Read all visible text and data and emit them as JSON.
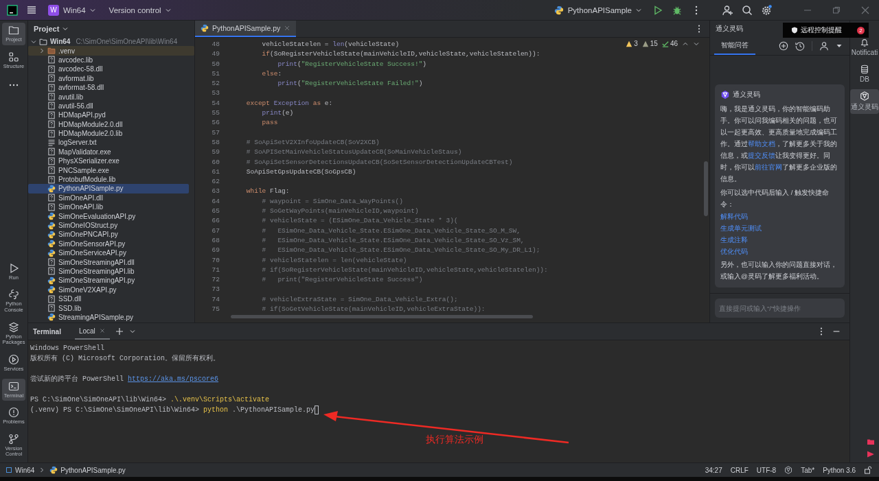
{
  "title_bar": {
    "project_badge": "W",
    "project": "Win64",
    "vcs": "Version control",
    "run_config": "PythonAPISample",
    "settings_dot": true
  },
  "tool_strip": {
    "top": [
      {
        "label": "Project",
        "kind": "folder",
        "selected": true
      },
      {
        "label": "Structure",
        "kind": "structure",
        "selected": false
      }
    ],
    "bottom": [
      {
        "label": "Run",
        "kind": "run",
        "selected": false
      },
      {
        "label": "Python Console",
        "kind": "console",
        "selected": false
      },
      {
        "label": "Python Packages",
        "kind": "packages",
        "selected": false
      },
      {
        "label": "Services",
        "kind": "services",
        "selected": false
      },
      {
        "label": "Terminal",
        "kind": "terminal",
        "selected": true
      },
      {
        "label": "Problems",
        "kind": "problems",
        "selected": false
      },
      {
        "label": "Version Control",
        "kind": "vcs",
        "selected": false
      }
    ]
  },
  "project": {
    "title": "Project",
    "tree": [
      {
        "name": "Win64",
        "path": "C:\\SimOne\\SimOneAPI\\lib\\Win64",
        "kind": "folder",
        "expanded": true,
        "selected": false,
        "children": [
          {
            "name": ".venv",
            "kind": "venv",
            "expanded": false,
            "selected": false
          },
          {
            "name": "avcodec.lib",
            "kind": "binary",
            "selected": false
          },
          {
            "name": "avcodec-58.dll",
            "kind": "binary",
            "selected": false
          },
          {
            "name": "avformat.lib",
            "kind": "binary",
            "selected": false
          },
          {
            "name": "avformat-58.dll",
            "kind": "binary",
            "selected": false
          },
          {
            "name": "avutil.lib",
            "kind": "binary",
            "selected": false
          },
          {
            "name": "avutil-56.dll",
            "kind": "binary",
            "selected": false
          },
          {
            "name": "HDMapAPI.pyd",
            "kind": "binary",
            "selected": false
          },
          {
            "name": "HDMapModule2.0.dll",
            "kind": "binary",
            "selected": false
          },
          {
            "name": "HDMapModule2.0.lib",
            "kind": "binary",
            "selected": false
          },
          {
            "name": "logServer.txt",
            "kind": "text",
            "selected": false
          },
          {
            "name": "MapValidator.exe",
            "kind": "binary",
            "selected": false
          },
          {
            "name": "PhysXSerializer.exe",
            "kind": "binary",
            "selected": false
          },
          {
            "name": "PNCSample.exe",
            "kind": "binary",
            "selected": false
          },
          {
            "name": "ProtobufModule.lib",
            "kind": "binary",
            "selected": false
          },
          {
            "name": "PythonAPISample.py",
            "kind": "python",
            "selected": true
          },
          {
            "name": "SimOneAPI.dll",
            "kind": "binary",
            "selected": false
          },
          {
            "name": "SimOneAPI.lib",
            "kind": "binary",
            "selected": false
          },
          {
            "name": "SimOneEvaluationAPI.py",
            "kind": "python",
            "selected": false
          },
          {
            "name": "SimOneIOStruct.py",
            "kind": "python",
            "selected": false
          },
          {
            "name": "SimOnePNCAPI.py",
            "kind": "python",
            "selected": false
          },
          {
            "name": "SimOneSensorAPI.py",
            "kind": "python",
            "selected": false
          },
          {
            "name": "SimOneServiceAPI.py",
            "kind": "python",
            "selected": false
          },
          {
            "name": "SimOneStreamingAPI.dll",
            "kind": "binary",
            "selected": false
          },
          {
            "name": "SimOneStreamingAPI.lib",
            "kind": "binary",
            "selected": false
          },
          {
            "name": "SimOneStreamingAPI.py",
            "kind": "python",
            "selected": false
          },
          {
            "name": "SimOneV2XAPI.py",
            "kind": "python",
            "selected": false
          },
          {
            "name": "SSD.dll",
            "kind": "binary",
            "selected": false
          },
          {
            "name": "SSD.lib",
            "kind": "binary",
            "selected": false
          },
          {
            "name": "StreamingAPISample.py",
            "kind": "python",
            "selected": false
          }
        ]
      }
    ]
  },
  "editor": {
    "tabs": [
      {
        "label": "PythonAPISample.py",
        "selected": true
      }
    ],
    "inspections": [
      {
        "kind": "error",
        "count": "3"
      },
      {
        "kind": "warning",
        "count": "15"
      },
      {
        "kind": "typo",
        "count": "46"
      }
    ],
    "lines": [
      {
        "number": "48",
        "tokens": [
          {
            "text": "        vehicleStatelen = ",
            "kind": "plain"
          },
          {
            "text": "len",
            "kind": "builtin"
          },
          {
            "text": "(vehicleState)",
            "kind": "plain"
          }
        ]
      },
      {
        "number": "49",
        "tokens": [
          {
            "text": "        if",
            "kind": "keyword"
          },
          {
            "text": "(SoRegisterVehicleState(mainVehicleID,vehicleState,vehicleStatelen)):",
            "kind": "plain"
          }
        ]
      },
      {
        "number": "50",
        "tokens": [
          {
            "text": "            print",
            "kind": "builtin"
          },
          {
            "text": "(",
            "kind": "plain"
          },
          {
            "text": "\"RegisterVehicleState Success!\"",
            "kind": "string"
          },
          {
            "text": ")",
            "kind": "plain"
          }
        ]
      },
      {
        "number": "51",
        "tokens": [
          {
            "text": "        else",
            "kind": "keyword"
          },
          {
            "text": ":",
            "kind": "plain"
          }
        ]
      },
      {
        "number": "52",
        "tokens": [
          {
            "text": "            print",
            "kind": "builtin"
          },
          {
            "text": "(",
            "kind": "plain"
          },
          {
            "text": "\"RegisterVehicleState Failed!\"",
            "kind": "string"
          },
          {
            "text": ")",
            "kind": "plain"
          }
        ]
      },
      {
        "number": "53"
      },
      {
        "number": "54",
        "tokens": [
          {
            "text": "    except ",
            "kind": "keyword"
          },
          {
            "text": "Exception",
            "kind": "builtin"
          },
          {
            "text": " as ",
            "kind": "keyword"
          },
          {
            "text": "e:",
            "kind": "plain"
          }
        ]
      },
      {
        "number": "55",
        "tokens": [
          {
            "text": "        print",
            "kind": "builtin"
          },
          {
            "text": "(e)",
            "kind": "plain"
          }
        ]
      },
      {
        "number": "56",
        "tokens": [
          {
            "text": "        pass",
            "kind": "keyword"
          }
        ]
      },
      {
        "number": "57"
      },
      {
        "number": "58",
        "tokens": [
          {
            "text": "    # SoApiSetV2XInfoUpdateCB(SoV2XCB)",
            "kind": "comment"
          }
        ]
      },
      {
        "number": "59",
        "tokens": [
          {
            "text": "    # SoAPISetMainVehicleStatusUpdateCB(SoMainVehicleStaus)",
            "kind": "comment"
          }
        ]
      },
      {
        "number": "60",
        "tokens": [
          {
            "text": "    # SoApiSetSensorDetectionsUpdateCB(SoSetSensorDetectionUpdateCBTest)",
            "kind": "comment"
          }
        ]
      },
      {
        "number": "61",
        "tokens": [
          {
            "text": "    SoApiSetGpsUpdateCB(SoGpsCB)",
            "kind": "plain"
          }
        ]
      },
      {
        "number": "62"
      },
      {
        "number": "63",
        "tokens": [
          {
            "text": "    while",
            "kind": "keyword"
          },
          {
            "text": " Flag:",
            "kind": "plain"
          }
        ]
      },
      {
        "number": "64",
        "tokens": [
          {
            "text": "        # waypoint = SimOne_Data_WayPoints()",
            "kind": "comment"
          }
        ]
      },
      {
        "number": "65",
        "tokens": [
          {
            "text": "        # SoGetWayPoints(mainVehicleID,waypoint)",
            "kind": "comment"
          }
        ]
      },
      {
        "number": "66",
        "tokens": [
          {
            "text": "        # vehicleState = (ESimOne_Data_Vehicle_State * 3)(",
            "kind": "comment"
          }
        ]
      },
      {
        "number": "67",
        "tokens": [
          {
            "text": "        #   ESimOne_Data_Vehicle_State.ESimOne_Data_Vehicle_State_SO_M_SW,",
            "kind": "comment"
          }
        ]
      },
      {
        "number": "68",
        "tokens": [
          {
            "text": "        #   ESimOne_Data_Vehicle_State.ESimOne_Data_Vehicle_State_SO_Vz_SM,",
            "kind": "comment"
          }
        ]
      },
      {
        "number": "69",
        "tokens": [
          {
            "text": "        #   ESimOne_Data_Vehicle_State.ESimOne_Data_Vehicle_State_SO_My_DR_L1);",
            "kind": "comment"
          }
        ]
      },
      {
        "number": "70",
        "tokens": [
          {
            "text": "        # vehicleStatelen = len(vehicleState)",
            "kind": "comment"
          }
        ]
      },
      {
        "number": "71",
        "tokens": [
          {
            "text": "        # if(SoRegisterVehicleState(mainVehicleID,vehicleState,vehicleStatelen)):",
            "kind": "comment"
          }
        ]
      },
      {
        "number": "72",
        "tokens": [
          {
            "text": "        #   print(\"RegisterVehicleState Success\")",
            "kind": "comment"
          }
        ]
      },
      {
        "number": "73"
      },
      {
        "number": "74",
        "tokens": [
          {
            "text": "        # vehicleExtraState = SimOne_Data_Vehicle_Extra();",
            "kind": "comment"
          }
        ]
      },
      {
        "number": "75",
        "tokens": [
          {
            "text": "        # if(SoGetVehicleState(mainVehicleID,vehicleExtraState)):",
            "kind": "comment"
          }
        ]
      }
    ]
  },
  "assistant": {
    "title": "通义灵码",
    "tabs": [
      {
        "label": "智能问答",
        "selected": true
      }
    ],
    "card_title": "通义灵码",
    "intro": [
      {
        "kind": "text",
        "text": "嗨，我是通义灵码，你的智能编码助手。你可以问我编码相关的问题，也可以一起更高效、更高质量地完成编码工作。通过"
      },
      {
        "kind": "link",
        "text": "帮助文档"
      },
      {
        "kind": "text",
        "text": "，了解更多关于我的信息，或"
      },
      {
        "kind": "link",
        "text": "提交反馈"
      },
      {
        "kind": "text",
        "text": "让我变得更好。同时，你可以"
      },
      {
        "kind": "link",
        "text": "前往官网"
      },
      {
        "kind": "text",
        "text": "了解更多企业版的信息。"
      }
    ],
    "hint": "你可以选中代码后输入 / 触发快捷命令：",
    "commands": [
      "解释代码",
      "生成单元测试",
      "生成注释",
      "优化代码"
    ],
    "outro": "另外，也可以输入你的问题直接对话，或输入@灵码了解更多福利活动。",
    "input_placeholder": "直接提问或输入\"/\"快捷操作"
  },
  "notification": {
    "text": "远程控制提醒",
    "count": "2"
  },
  "side_strip": [
    {
      "label": "Notificati",
      "kind": "bell",
      "selected": false
    },
    {
      "label": "DB",
      "kind": "database",
      "selected": false
    },
    {
      "label": "通义灵码",
      "kind": "assistant",
      "selected": true
    }
  ],
  "terminal": {
    "title": "Terminal",
    "tabs": [
      {
        "label": "Local",
        "selected": true
      }
    ],
    "lines": [
      {
        "segments": [
          {
            "kind": "plain",
            "text": "Windows PowerShell"
          }
        ]
      },
      {
        "segments": [
          {
            "kind": "plain",
            "text": "版权所有 (C) Microsoft Corporation。保留所有权利。"
          }
        ]
      },
      {
        "gap_before": true,
        "segments": [
          {
            "kind": "plain",
            "text": "尝试新的跨平台 PowerShell "
          },
          {
            "kind": "link",
            "text": "https://aka.ms/pscore6"
          }
        ]
      },
      {
        "gap_before": true,
        "segments": [
          {
            "kind": "plain",
            "text": "PS C:\\SimOne\\SimOneAPI\\lib\\Win64> "
          },
          {
            "kind": "command",
            "text": ".\\.venv\\Scripts\\activate"
          }
        ]
      },
      {
        "cursor": true,
        "segments": [
          {
            "kind": "plain",
            "text": "(.venv) PS C:\\SimOne\\SimOneAPI\\lib\\Win64> "
          },
          {
            "kind": "command",
            "text": "python"
          },
          {
            "kind": "plain",
            "text": " .\\PythonAPISample.py"
          }
        ]
      }
    ]
  },
  "annotation": {
    "text": "执行算法示例"
  },
  "status_bar": {
    "breadcrumbs": [
      "Win64",
      "PythonAPISample.py"
    ],
    "position": "34:27",
    "line_separator": "CRLF",
    "encoding": "UTF-8",
    "indent": "Tab*",
    "interpreter": "Python 3.6"
  }
}
